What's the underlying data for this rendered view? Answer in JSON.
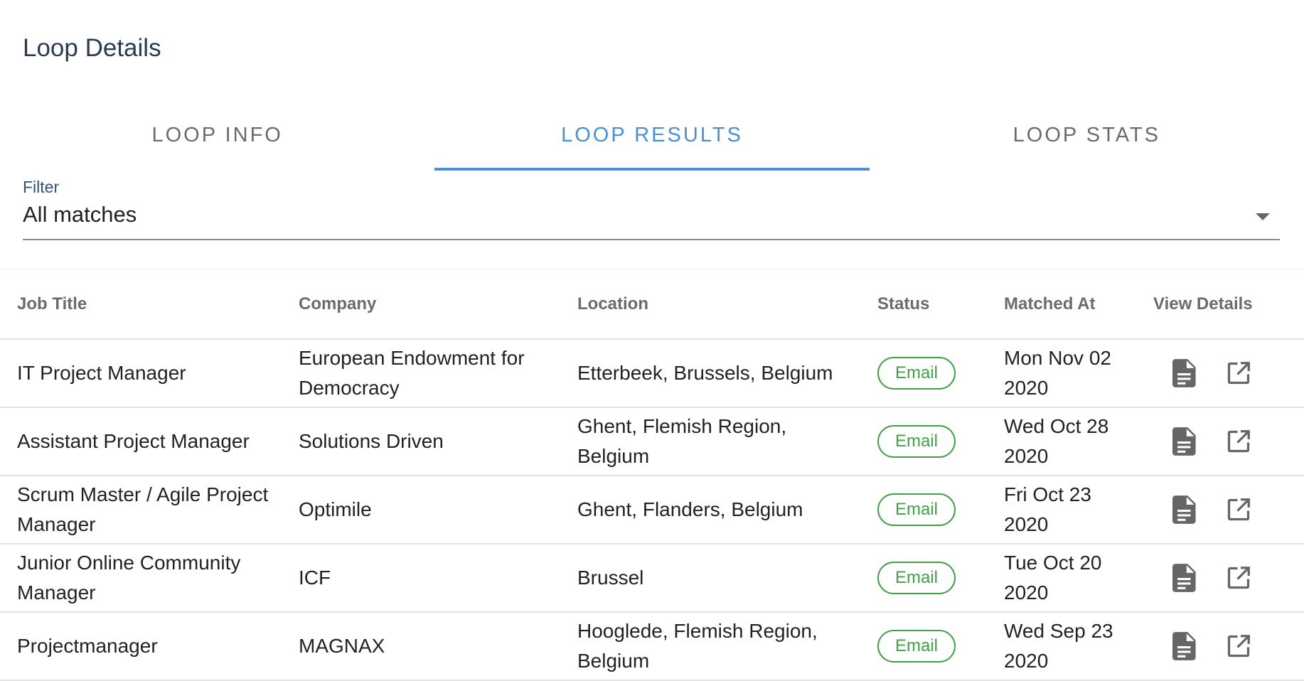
{
  "page": {
    "title": "Loop Details"
  },
  "tabs": [
    {
      "label": "LOOP INFO",
      "active": false
    },
    {
      "label": "LOOP RESULTS",
      "active": true
    },
    {
      "label": "LOOP STATS",
      "active": false
    }
  ],
  "filter": {
    "label": "Filter",
    "value": "All matches"
  },
  "table": {
    "headers": {
      "job_title": "Job Title",
      "company": "Company",
      "location": "Location",
      "status": "Status",
      "matched_at": "Matched At",
      "view_details": "View Details"
    },
    "rows": [
      {
        "job_title": "IT Project Manager",
        "company": "European Endowment for Democracy",
        "location": "Etterbeek, Brussels, Belgium",
        "status": "Email",
        "matched_at": "Mon Nov 02 2020"
      },
      {
        "job_title": "Assistant Project Manager",
        "company": "Solutions Driven",
        "location": "Ghent, Flemish Region, Belgium",
        "status": "Email",
        "matched_at": "Wed Oct 28 2020"
      },
      {
        "job_title": "Scrum Master / Agile Project Manager",
        "company": "Optimile",
        "location": "Ghent, Flanders, Belgium",
        "status": "Email",
        "matched_at": "Fri Oct 23 2020"
      },
      {
        "job_title": "Junior Online Community Manager",
        "company": "ICF",
        "location": "Brussel",
        "status": "Email",
        "matched_at": "Tue Oct 20 2020"
      },
      {
        "job_title": "Projectmanager",
        "company": "MAGNAX",
        "location": "Hooglede, Flemish Region, Belgium",
        "status": "Email",
        "matched_at": "Wed Sep 23 2020"
      }
    ]
  },
  "icons": {
    "document": "document-icon",
    "open_external": "open-in-new-icon",
    "dropdown": "chevron-down-icon"
  },
  "colors": {
    "accent": "#4a90d9",
    "status_green": "#43a047",
    "icon_gray": "#666666"
  }
}
